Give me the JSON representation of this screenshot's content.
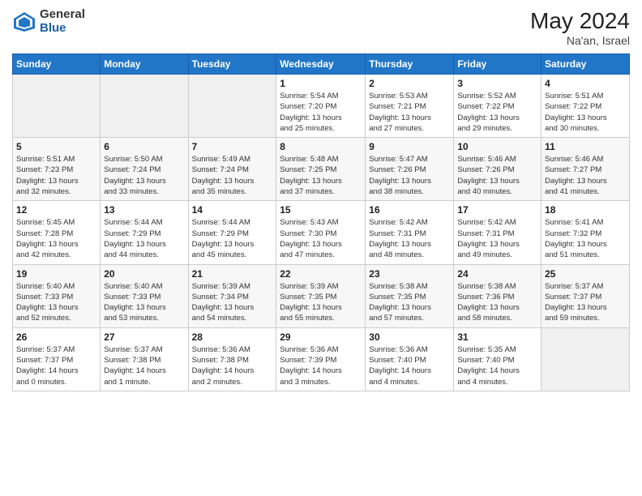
{
  "logo": {
    "general": "General",
    "blue": "Blue"
  },
  "header": {
    "month_year": "May 2024",
    "location": "Na'an, Israel"
  },
  "weekdays": [
    "Sunday",
    "Monday",
    "Tuesday",
    "Wednesday",
    "Thursday",
    "Friday",
    "Saturday"
  ],
  "weeks": [
    [
      {
        "day": "",
        "info": ""
      },
      {
        "day": "",
        "info": ""
      },
      {
        "day": "",
        "info": ""
      },
      {
        "day": "1",
        "info": "Sunrise: 5:54 AM\nSunset: 7:20 PM\nDaylight: 13 hours\nand 25 minutes."
      },
      {
        "day": "2",
        "info": "Sunrise: 5:53 AM\nSunset: 7:21 PM\nDaylight: 13 hours\nand 27 minutes."
      },
      {
        "day": "3",
        "info": "Sunrise: 5:52 AM\nSunset: 7:22 PM\nDaylight: 13 hours\nand 29 minutes."
      },
      {
        "day": "4",
        "info": "Sunrise: 5:51 AM\nSunset: 7:22 PM\nDaylight: 13 hours\nand 30 minutes."
      }
    ],
    [
      {
        "day": "5",
        "info": "Sunrise: 5:51 AM\nSunset: 7:23 PM\nDaylight: 13 hours\nand 32 minutes."
      },
      {
        "day": "6",
        "info": "Sunrise: 5:50 AM\nSunset: 7:24 PM\nDaylight: 13 hours\nand 33 minutes."
      },
      {
        "day": "7",
        "info": "Sunrise: 5:49 AM\nSunset: 7:24 PM\nDaylight: 13 hours\nand 35 minutes."
      },
      {
        "day": "8",
        "info": "Sunrise: 5:48 AM\nSunset: 7:25 PM\nDaylight: 13 hours\nand 37 minutes."
      },
      {
        "day": "9",
        "info": "Sunrise: 5:47 AM\nSunset: 7:26 PM\nDaylight: 13 hours\nand 38 minutes."
      },
      {
        "day": "10",
        "info": "Sunrise: 5:46 AM\nSunset: 7:26 PM\nDaylight: 13 hours\nand 40 minutes."
      },
      {
        "day": "11",
        "info": "Sunrise: 5:46 AM\nSunset: 7:27 PM\nDaylight: 13 hours\nand 41 minutes."
      }
    ],
    [
      {
        "day": "12",
        "info": "Sunrise: 5:45 AM\nSunset: 7:28 PM\nDaylight: 13 hours\nand 42 minutes."
      },
      {
        "day": "13",
        "info": "Sunrise: 5:44 AM\nSunset: 7:29 PM\nDaylight: 13 hours\nand 44 minutes."
      },
      {
        "day": "14",
        "info": "Sunrise: 5:44 AM\nSunset: 7:29 PM\nDaylight: 13 hours\nand 45 minutes."
      },
      {
        "day": "15",
        "info": "Sunrise: 5:43 AM\nSunset: 7:30 PM\nDaylight: 13 hours\nand 47 minutes."
      },
      {
        "day": "16",
        "info": "Sunrise: 5:42 AM\nSunset: 7:31 PM\nDaylight: 13 hours\nand 48 minutes."
      },
      {
        "day": "17",
        "info": "Sunrise: 5:42 AM\nSunset: 7:31 PM\nDaylight: 13 hours\nand 49 minutes."
      },
      {
        "day": "18",
        "info": "Sunrise: 5:41 AM\nSunset: 7:32 PM\nDaylight: 13 hours\nand 51 minutes."
      }
    ],
    [
      {
        "day": "19",
        "info": "Sunrise: 5:40 AM\nSunset: 7:33 PM\nDaylight: 13 hours\nand 52 minutes."
      },
      {
        "day": "20",
        "info": "Sunrise: 5:40 AM\nSunset: 7:33 PM\nDaylight: 13 hours\nand 53 minutes."
      },
      {
        "day": "21",
        "info": "Sunrise: 5:39 AM\nSunset: 7:34 PM\nDaylight: 13 hours\nand 54 minutes."
      },
      {
        "day": "22",
        "info": "Sunrise: 5:39 AM\nSunset: 7:35 PM\nDaylight: 13 hours\nand 55 minutes."
      },
      {
        "day": "23",
        "info": "Sunrise: 5:38 AM\nSunset: 7:35 PM\nDaylight: 13 hours\nand 57 minutes."
      },
      {
        "day": "24",
        "info": "Sunrise: 5:38 AM\nSunset: 7:36 PM\nDaylight: 13 hours\nand 58 minutes."
      },
      {
        "day": "25",
        "info": "Sunrise: 5:37 AM\nSunset: 7:37 PM\nDaylight: 13 hours\nand 59 minutes."
      }
    ],
    [
      {
        "day": "26",
        "info": "Sunrise: 5:37 AM\nSunset: 7:37 PM\nDaylight: 14 hours\nand 0 minutes."
      },
      {
        "day": "27",
        "info": "Sunrise: 5:37 AM\nSunset: 7:38 PM\nDaylight: 14 hours\nand 1 minute."
      },
      {
        "day": "28",
        "info": "Sunrise: 5:36 AM\nSunset: 7:38 PM\nDaylight: 14 hours\nand 2 minutes."
      },
      {
        "day": "29",
        "info": "Sunrise: 5:36 AM\nSunset: 7:39 PM\nDaylight: 14 hours\nand 3 minutes."
      },
      {
        "day": "30",
        "info": "Sunrise: 5:36 AM\nSunset: 7:40 PM\nDaylight: 14 hours\nand 4 minutes."
      },
      {
        "day": "31",
        "info": "Sunrise: 5:35 AM\nSunset: 7:40 PM\nDaylight: 14 hours\nand 4 minutes."
      },
      {
        "day": "",
        "info": ""
      }
    ]
  ]
}
